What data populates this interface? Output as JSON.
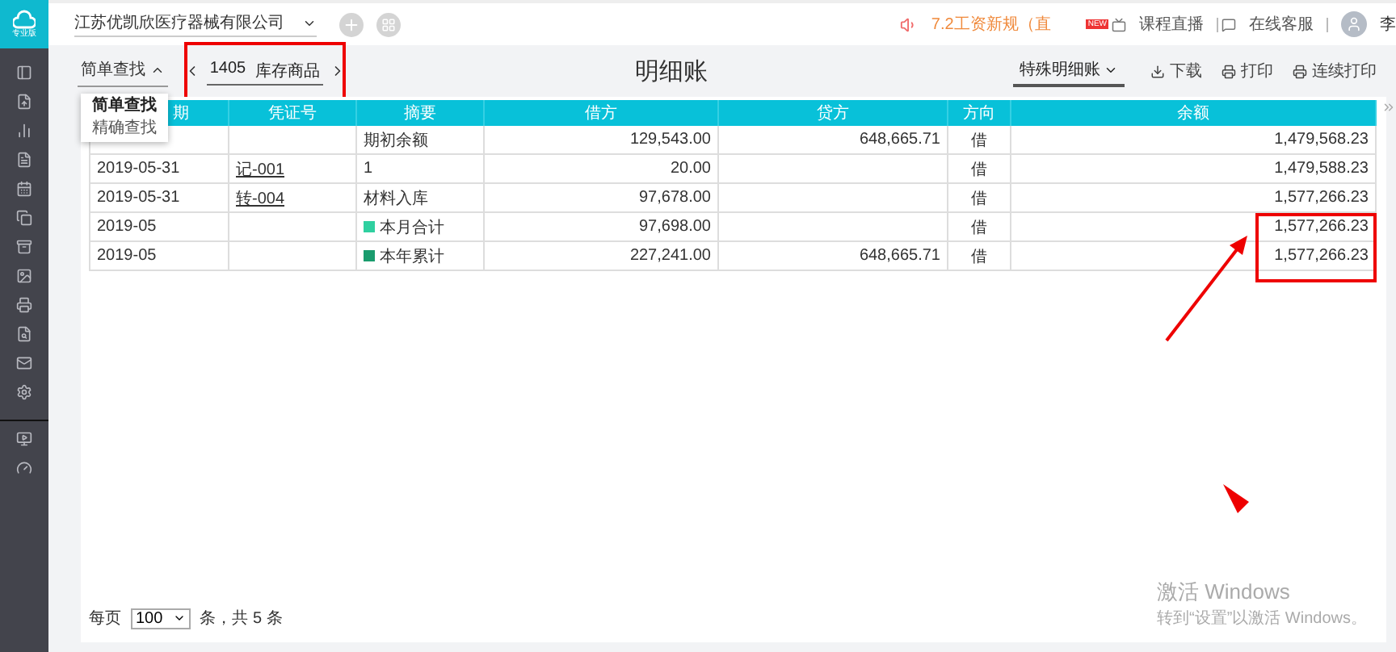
{
  "top_bar": {
    "company": "江苏优凯欣医疗器械有限公司",
    "notice": "7.2工资新规（直",
    "new_badge": "NEW",
    "links": [
      {
        "label": "课程直播",
        "kind": "live"
      },
      {
        "label": "在线客服",
        "kind": "service"
      }
    ],
    "user": "李"
  },
  "logo": {
    "label": "专业版"
  },
  "toolbar": {
    "search_mode": {
      "label": "简单查找",
      "expanded": true
    },
    "search_options": [
      {
        "label": "简单查找",
        "selected": true
      },
      {
        "label": "精确查找",
        "selected": false
      }
    ],
    "account": {
      "code": "1405",
      "name": "库存商品"
    },
    "title": "明细账",
    "ledger_type": "特殊明细账",
    "actions": [
      {
        "label": "下载",
        "kind": "download"
      },
      {
        "label": "打印",
        "kind": "print"
      },
      {
        "label": "连续打印",
        "kind": "print-batch"
      }
    ]
  },
  "table": {
    "columns": [
      "期",
      "凭证号",
      "摘要",
      "借方",
      "贷方",
      "方向",
      "余额"
    ],
    "rows": [
      {
        "date": "",
        "voucher": "",
        "summary": "期初余额",
        "kind": "entry",
        "debit": "129,543.00",
        "credit": "648,665.71",
        "direction": "借",
        "balance": "1,479,568.23"
      },
      {
        "date": "2019-05-31",
        "voucher": "记-001",
        "summary": "1",
        "kind": "entry",
        "debit": "20.00",
        "credit": "",
        "direction": "借",
        "balance": "1,479,588.23"
      },
      {
        "date": "2019-05-31",
        "voucher": "转-004",
        "summary": "材料入库",
        "kind": "entry",
        "debit": "97,678.00",
        "credit": "",
        "direction": "借",
        "balance": "1,577,266.23"
      },
      {
        "date": "2019-05",
        "voucher": "",
        "summary": "本月合计",
        "kind": "month",
        "debit": "97,698.00",
        "credit": "",
        "direction": "借",
        "balance": "1,577,266.23"
      },
      {
        "date": "2019-05",
        "voucher": "",
        "summary": "本年累计",
        "kind": "year",
        "debit": "227,241.00",
        "credit": "648,665.71",
        "direction": "借",
        "balance": "1,577,266.23"
      }
    ]
  },
  "pager": {
    "prefix": "每页",
    "page_size": "100",
    "summary": "条，共 5 条"
  },
  "os_notice": {
    "title": "激活 Windows",
    "body": "转到“设置”以激活 Windows。"
  }
}
